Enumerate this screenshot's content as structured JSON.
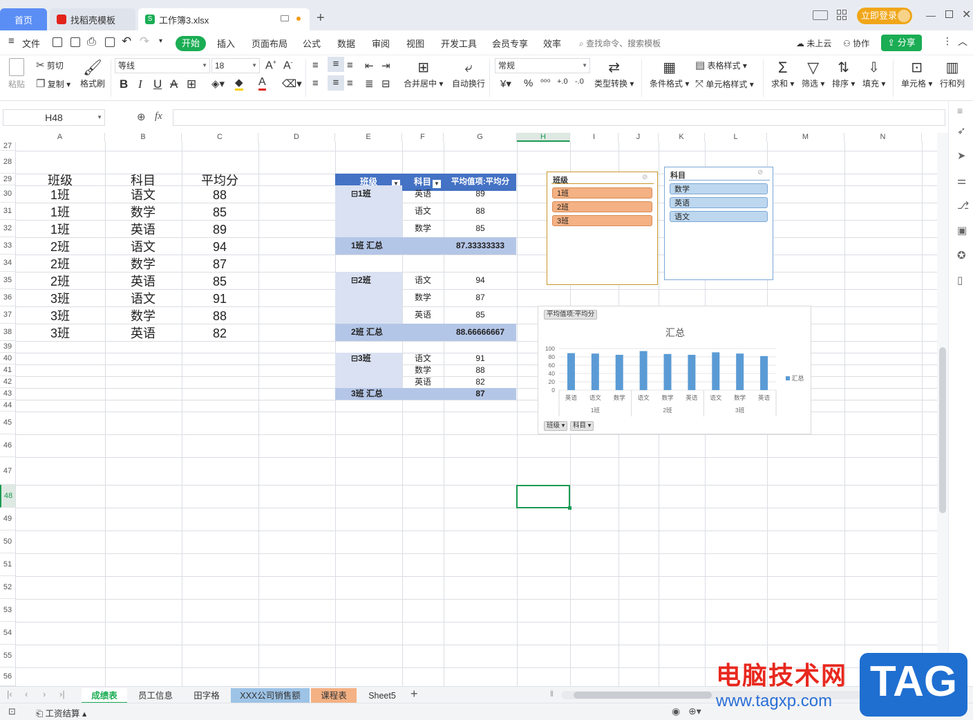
{
  "tabs": {
    "home": "首页",
    "template": "找稻壳模板",
    "workbook": "工作簿3.xlsx"
  },
  "titlebar": {
    "login": "立即登录"
  },
  "menu": {
    "file": "文件",
    "items": [
      "开始",
      "插入",
      "页面布局",
      "公式",
      "数据",
      "审阅",
      "视图",
      "开发工具",
      "会员专享",
      "效率"
    ],
    "search": "查找命令、搜索模板",
    "cloud": "未上云",
    "collab": "协作",
    "share": "分享"
  },
  "ribbon": {
    "paste": "粘贴",
    "cut": "剪切",
    "copy": "复制",
    "format_painter": "格式刷",
    "font": "等线",
    "font_size": "18",
    "merge": "合并居中",
    "wrap": "自动换行",
    "number_format": "常规",
    "type_convert": "类型转换",
    "cond_format": "条件格式",
    "table_style": "表格样式",
    "cell_style": "单元格样式",
    "sum": "求和",
    "filter": "筛选",
    "sort": "排序",
    "fill": "填充",
    "cell": "单元格",
    "rowcol": "行和列"
  },
  "formula_bar": {
    "name_box": "H48",
    "fx": "fx",
    "formula": ""
  },
  "columns": [
    "A",
    "B",
    "C",
    "D",
    "E",
    "F",
    "G",
    "H",
    "I",
    "J",
    "K",
    "L",
    "M",
    "N"
  ],
  "rows": [
    "27",
    "28",
    "29",
    "30",
    "31",
    "32",
    "33",
    "34",
    "35",
    "36",
    "37",
    "38",
    "39",
    "40",
    "41",
    "42",
    "43",
    "44",
    "45",
    "46",
    "47",
    "48",
    "49",
    "50",
    "51",
    "52",
    "53",
    "54",
    "55",
    "56"
  ],
  "table": {
    "headers": [
      "班级",
      "科目",
      "平均分"
    ],
    "rows": [
      [
        "1班",
        "语文",
        "88"
      ],
      [
        "1班",
        "数学",
        "85"
      ],
      [
        "1班",
        "英语",
        "89"
      ],
      [
        "2班",
        "语文",
        "94"
      ],
      [
        "2班",
        "数学",
        "87"
      ],
      [
        "2班",
        "英语",
        "85"
      ],
      [
        "3班",
        "语文",
        "91"
      ],
      [
        "3班",
        "数学",
        "88"
      ],
      [
        "3班",
        "英语",
        "82"
      ]
    ]
  },
  "pivot": {
    "headers": [
      "班级",
      "科目",
      "平均值项:平均分"
    ],
    "groups": [
      {
        "name": "⊟1班",
        "rows": [
          [
            "英语",
            "89"
          ],
          [
            "语文",
            "88"
          ],
          [
            "数学",
            "85"
          ]
        ],
        "total_label": "1班 汇总",
        "total": "87.33333333"
      },
      {
        "name": "⊟2班",
        "rows": [
          [
            "语文",
            "94"
          ],
          [
            "数学",
            "87"
          ],
          [
            "英语",
            "85"
          ]
        ],
        "total_label": "2班 汇总",
        "total": "88.66666667"
      },
      {
        "name": "⊟3班",
        "rows": [
          [
            "语文",
            "91"
          ],
          [
            "数学",
            "88"
          ],
          [
            "英语",
            "82"
          ]
        ],
        "total_label": "3班 汇总",
        "total": "87"
      }
    ]
  },
  "slicer_class": {
    "title": "班级",
    "items": [
      "1班",
      "2班",
      "3班"
    ]
  },
  "slicer_subject": {
    "title": "科目",
    "items": [
      "数学",
      "英语",
      "语文"
    ]
  },
  "chart_data": {
    "type": "bar",
    "title": "汇总",
    "field_button": "平均值项:平均分",
    "categories": [
      "英语",
      "语文",
      "数学",
      "语文",
      "数学",
      "英语",
      "语文",
      "数学",
      "英语"
    ],
    "groups": [
      "1班",
      "2班",
      "3班"
    ],
    "series": [
      {
        "name": "汇总",
        "values": [
          89,
          88,
          85,
          94,
          87,
          85,
          91,
          88,
          82
        ]
      }
    ],
    "yticks": [
      "0",
      "20",
      "40",
      "60",
      "80",
      "100"
    ],
    "ylim": [
      0,
      100
    ],
    "color": "#5b9bd5",
    "filter_buttons": [
      "班级",
      "科目"
    ],
    "legend_position": "right"
  },
  "sheets": [
    "成绩表",
    "员工信息",
    "田字格",
    "XXX公司销售额",
    "课程表",
    "Sheet5"
  ],
  "status": {
    "macro": "工资结算"
  },
  "watermark": {
    "text1": "电脑技术网",
    "text2": "www.tagxp.com",
    "tag": "TAG"
  },
  "colors": {
    "accent": "#1aad54",
    "pivot_header": "#4472c4",
    "pivot_total": "#b4c6e7",
    "pivot_band": "#d9e1f2",
    "slicer_selected": "#f4b183",
    "slicer_blue": "#bdd7ee"
  }
}
